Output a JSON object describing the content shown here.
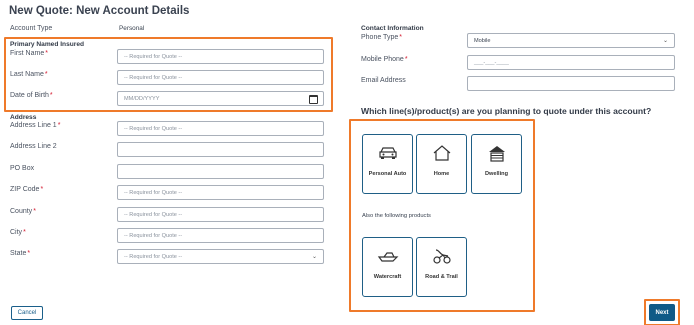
{
  "page": {
    "title": "New Quote: New Account Details"
  },
  "account": {
    "type_label": "Account Type",
    "type_value": "Personal"
  },
  "primary_insured": {
    "section_label": "Primary Named Insured",
    "first_name": {
      "label": "First Name",
      "placeholder": "-- Required for Quote --"
    },
    "last_name": {
      "label": "Last Name",
      "placeholder": "-- Required for Quote --"
    },
    "dob": {
      "label": "Date of Birth",
      "placeholder": "MM/DD/YYYY"
    }
  },
  "address": {
    "section_label": "Address",
    "line1": {
      "label": "Address Line 1",
      "placeholder": "-- Required for Quote --"
    },
    "line2": {
      "label": "Address Line 2",
      "placeholder": ""
    },
    "po_box": {
      "label": "PO Box",
      "placeholder": ""
    },
    "zip": {
      "label": "ZIP Code",
      "placeholder": "-- Required for Quote --"
    },
    "county": {
      "label": "County",
      "placeholder": "-- Required for Quote --"
    },
    "city": {
      "label": "City",
      "placeholder": "-- Required for Quote --"
    },
    "state": {
      "label": "State",
      "selected": "-- Required for Quote --"
    }
  },
  "contact": {
    "section_label": "Contact Information",
    "phone_type": {
      "label": "Phone Type",
      "selected": "Mobile"
    },
    "mobile_phone": {
      "label": "Mobile Phone",
      "placeholder": "___-___-____"
    },
    "email": {
      "label": "Email Address",
      "placeholder": ""
    }
  },
  "products": {
    "question": "Which line(s)/product(s) are you planning to quote under this account?",
    "primary": [
      {
        "label": "Personal Auto",
        "icon": "car-icon"
      },
      {
        "label": "Home",
        "icon": "house-icon"
      },
      {
        "label": "Dwelling",
        "icon": "dwelling-icon"
      }
    ],
    "also_label": "Also the following products",
    "secondary": [
      {
        "label": "Watercraft",
        "icon": "boat-icon"
      },
      {
        "label": "Road & Trail",
        "icon": "atv-icon"
      }
    ]
  },
  "actions": {
    "cancel": "Cancel",
    "next": "Next"
  },
  "colors": {
    "accent": "#0f5a87",
    "highlight": "#ef7a2a",
    "required": "#d3162b"
  }
}
